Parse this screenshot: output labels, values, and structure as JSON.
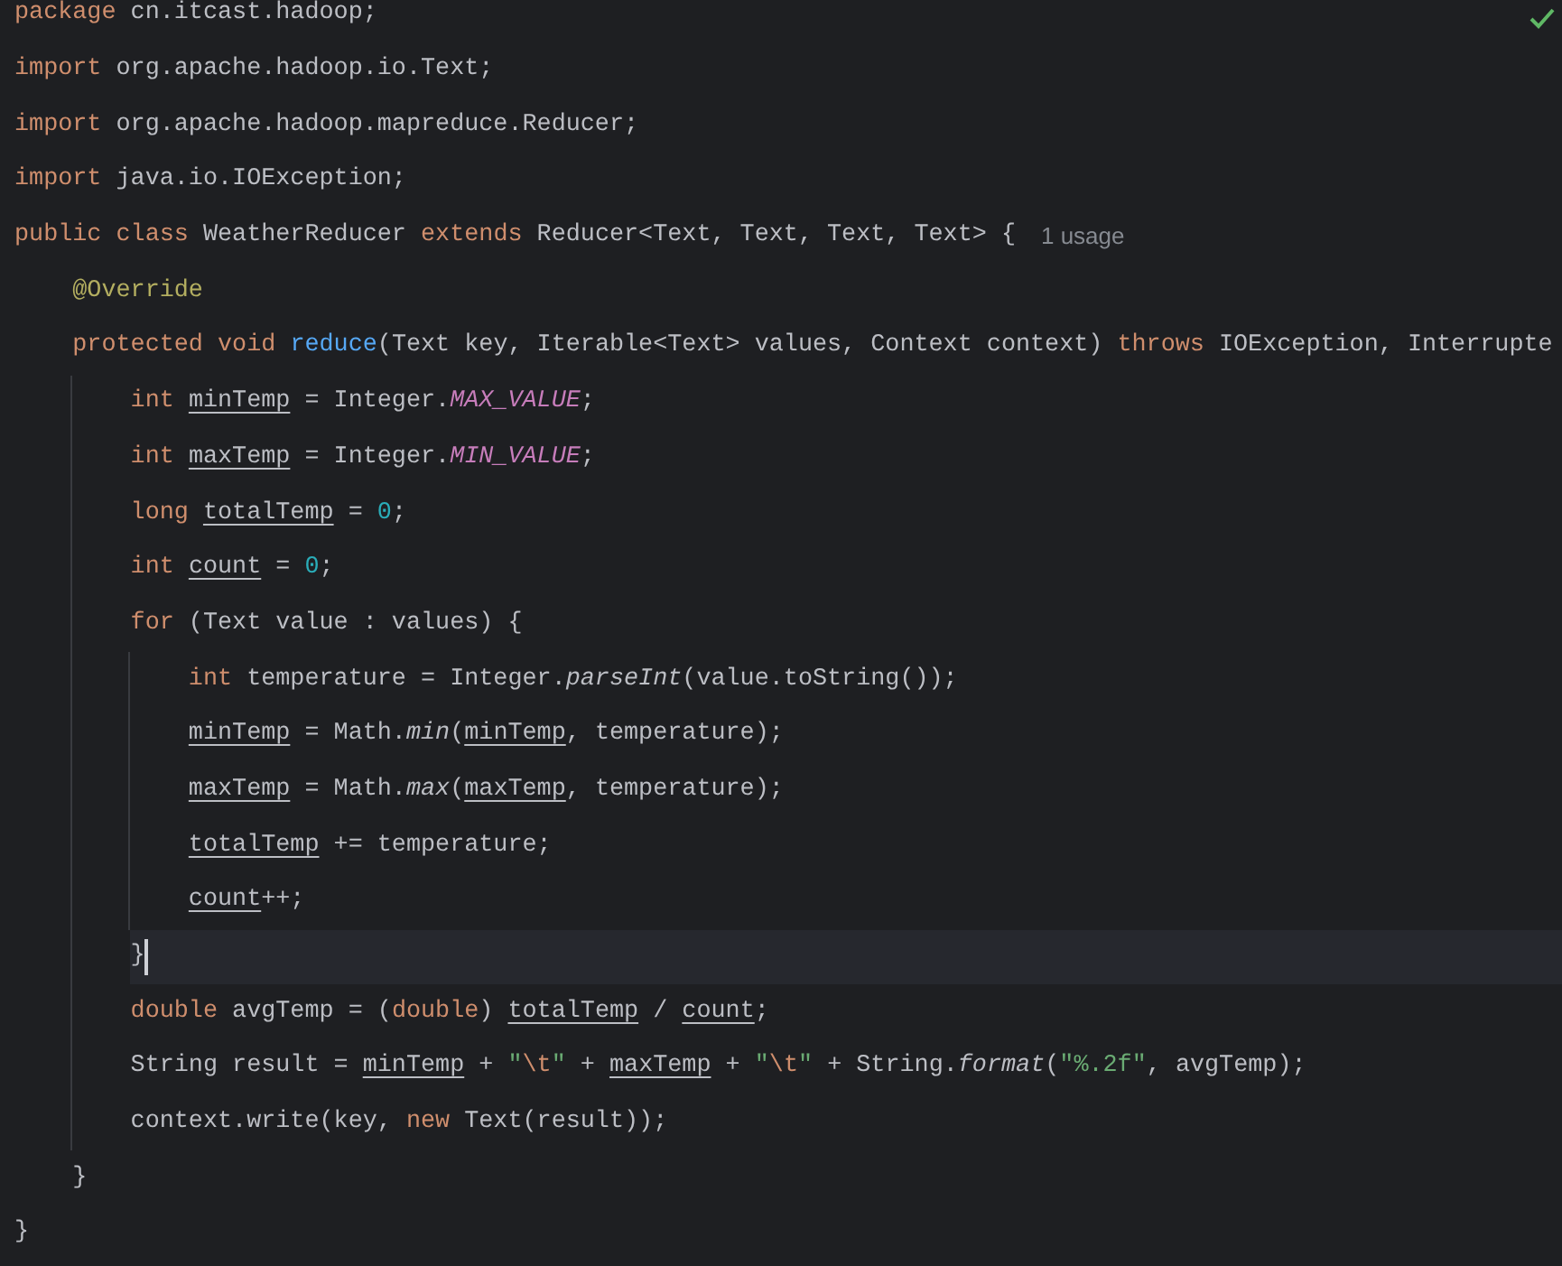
{
  "lines": [
    {
      "current": false,
      "tokens": [
        {
          "t": "package",
          "kind": "kw"
        },
        {
          "t": " cn.itcast.hadoop;",
          "kind": "plain"
        }
      ]
    },
    {
      "current": false,
      "tokens": [
        {
          "t": "import",
          "kind": "kw"
        },
        {
          "t": " org.apache.hadoop.io.Text;",
          "kind": "plain"
        }
      ]
    },
    {
      "current": false,
      "tokens": [
        {
          "t": "import",
          "kind": "kw"
        },
        {
          "t": " org.apache.hadoop.mapreduce.Reducer;",
          "kind": "plain"
        }
      ]
    },
    {
      "current": false,
      "tokens": [
        {
          "t": "import",
          "kind": "kw"
        },
        {
          "t": " java.io.IOException;",
          "kind": "plain"
        }
      ]
    },
    {
      "current": false,
      "tokens": [
        {
          "t": "public class",
          "kind": "kw"
        },
        {
          "t": " WeatherReducer ",
          "kind": "plain"
        },
        {
          "t": "extends",
          "kind": "kw"
        },
        {
          "t": " Reducer<Text, Text, Text, Text> {",
          "kind": "plain"
        },
        {
          "t": "1 usage",
          "kind": "hint"
        }
      ],
      "children": [
        {
          "current": false,
          "tokens": [
            {
              "t": "@Override",
              "kind": "anno"
            }
          ]
        },
        {
          "current": false,
          "tokens": [
            {
              "t": "protected void ",
              "kind": "kw"
            },
            {
              "t": "reduce",
              "kind": "fn"
            },
            {
              "t": "(Text key, Iterable<Text> values, Context context) ",
              "kind": "plain"
            },
            {
              "t": "throws",
              "kind": "kw"
            },
            {
              "t": " IOException, Interrupte",
              "kind": "plain"
            }
          ],
          "children": [
            {
              "current": false,
              "tokens": [
                {
                  "t": "int ",
                  "kind": "kw"
                },
                {
                  "t": "minTemp",
                  "kind": "var"
                },
                {
                  "t": " = Integer.",
                  "kind": "plain"
                },
                {
                  "t": "MAX_VALUE",
                  "kind": "const"
                },
                {
                  "t": ";",
                  "kind": "plain"
                }
              ]
            },
            {
              "current": false,
              "tokens": [
                {
                  "t": "int ",
                  "kind": "kw"
                },
                {
                  "t": "maxTemp",
                  "kind": "var"
                },
                {
                  "t": " = Integer.",
                  "kind": "plain"
                },
                {
                  "t": "MIN_VALUE",
                  "kind": "const"
                },
                {
                  "t": ";",
                  "kind": "plain"
                }
              ]
            },
            {
              "current": false,
              "tokens": [
                {
                  "t": "long ",
                  "kind": "kw"
                },
                {
                  "t": "totalTemp",
                  "kind": "var"
                },
                {
                  "t": " = ",
                  "kind": "plain"
                },
                {
                  "t": "0",
                  "kind": "num"
                },
                {
                  "t": ";",
                  "kind": "plain"
                }
              ]
            },
            {
              "current": false,
              "tokens": [
                {
                  "t": "int ",
                  "kind": "kw"
                },
                {
                  "t": "count",
                  "kind": "var"
                },
                {
                  "t": " = ",
                  "kind": "plain"
                },
                {
                  "t": "0",
                  "kind": "num"
                },
                {
                  "t": ";",
                  "kind": "plain"
                }
              ]
            },
            {
              "current": false,
              "tokens": [
                {
                  "t": "for",
                  "kind": "kw"
                },
                {
                  "t": " (Text value : values) {",
                  "kind": "plain"
                }
              ],
              "children": [
                {
                  "current": false,
                  "tokens": [
                    {
                      "t": "int",
                      "kind": "kw"
                    },
                    {
                      "t": " temperature = Integer.",
                      "kind": "plain"
                    },
                    {
                      "t": "parseInt",
                      "kind": "static"
                    },
                    {
                      "t": "(value.toString());",
                      "kind": "plain"
                    }
                  ]
                },
                {
                  "current": false,
                  "tokens": [
                    {
                      "t": "minTemp",
                      "kind": "var"
                    },
                    {
                      "t": " = Math.",
                      "kind": "plain"
                    },
                    {
                      "t": "min",
                      "kind": "static"
                    },
                    {
                      "t": "(",
                      "kind": "plain"
                    },
                    {
                      "t": "minTemp",
                      "kind": "var"
                    },
                    {
                      "t": ", temperature);",
                      "kind": "plain"
                    }
                  ]
                },
                {
                  "current": false,
                  "tokens": [
                    {
                      "t": "maxTemp",
                      "kind": "var"
                    },
                    {
                      "t": " = Math.",
                      "kind": "plain"
                    },
                    {
                      "t": "max",
                      "kind": "static"
                    },
                    {
                      "t": "(",
                      "kind": "plain"
                    },
                    {
                      "t": "maxTemp",
                      "kind": "var"
                    },
                    {
                      "t": ", temperature);",
                      "kind": "plain"
                    }
                  ]
                },
                {
                  "current": false,
                  "tokens": [
                    {
                      "t": "totalTemp",
                      "kind": "var"
                    },
                    {
                      "t": " += temperature;",
                      "kind": "plain"
                    }
                  ]
                },
                {
                  "current": false,
                  "tokens": [
                    {
                      "t": "count",
                      "kind": "var"
                    },
                    {
                      "t": "++;",
                      "kind": "plain"
                    }
                  ]
                }
              ]
            },
            {
              "current": true,
              "tokens": [
                {
                  "t": "}",
                  "kind": "plain"
                }
              ]
            },
            {
              "current": false,
              "tokens": [
                {
                  "t": "double",
                  "kind": "kw"
                },
                {
                  "t": " avgTemp = (",
                  "kind": "plain"
                },
                {
                  "t": "double",
                  "kind": "kw"
                },
                {
                  "t": ") ",
                  "kind": "plain"
                },
                {
                  "t": "totalTemp",
                  "kind": "var"
                },
                {
                  "t": " / ",
                  "kind": "plain"
                },
                {
                  "t": "count",
                  "kind": "var"
                },
                {
                  "t": ";",
                  "kind": "plain"
                }
              ]
            },
            {
              "current": false,
              "tokens": [
                {
                  "t": "String result = ",
                  "kind": "plain"
                },
                {
                  "t": "minTemp",
                  "kind": "var"
                },
                {
                  "t": " + ",
                  "kind": "plain"
                },
                {
                  "t": "\"",
                  "kind": "str"
                },
                {
                  "t": "\\t",
                  "kind": "esc"
                },
                {
                  "t": "\"",
                  "kind": "str"
                },
                {
                  "t": " + ",
                  "kind": "plain"
                },
                {
                  "t": "maxTemp",
                  "kind": "var"
                },
                {
                  "t": " + ",
                  "kind": "plain"
                },
                {
                  "t": "\"",
                  "kind": "str"
                },
                {
                  "t": "\\t",
                  "kind": "esc"
                },
                {
                  "t": "\"",
                  "kind": "str"
                },
                {
                  "t": " + String.",
                  "kind": "plain"
                },
                {
                  "t": "format",
                  "kind": "static"
                },
                {
                  "t": "(",
                  "kind": "plain"
                },
                {
                  "t": "\"%.2f\"",
                  "kind": "str"
                },
                {
                  "t": ", avgTemp);",
                  "kind": "plain"
                }
              ]
            },
            {
              "current": false,
              "tokens": [
                {
                  "t": "context.write(key, ",
                  "kind": "plain"
                },
                {
                  "t": "new",
                  "kind": "kw"
                },
                {
                  "t": " Text(result));",
                  "kind": "plain"
                }
              ]
            }
          ]
        },
        {
          "current": false,
          "tokens": [
            {
              "t": "}",
              "kind": "plain"
            }
          ]
        }
      ]
    },
    {
      "current": false,
      "tokens": [
        {
          "t": "}",
          "kind": "plain"
        }
      ]
    }
  ]
}
